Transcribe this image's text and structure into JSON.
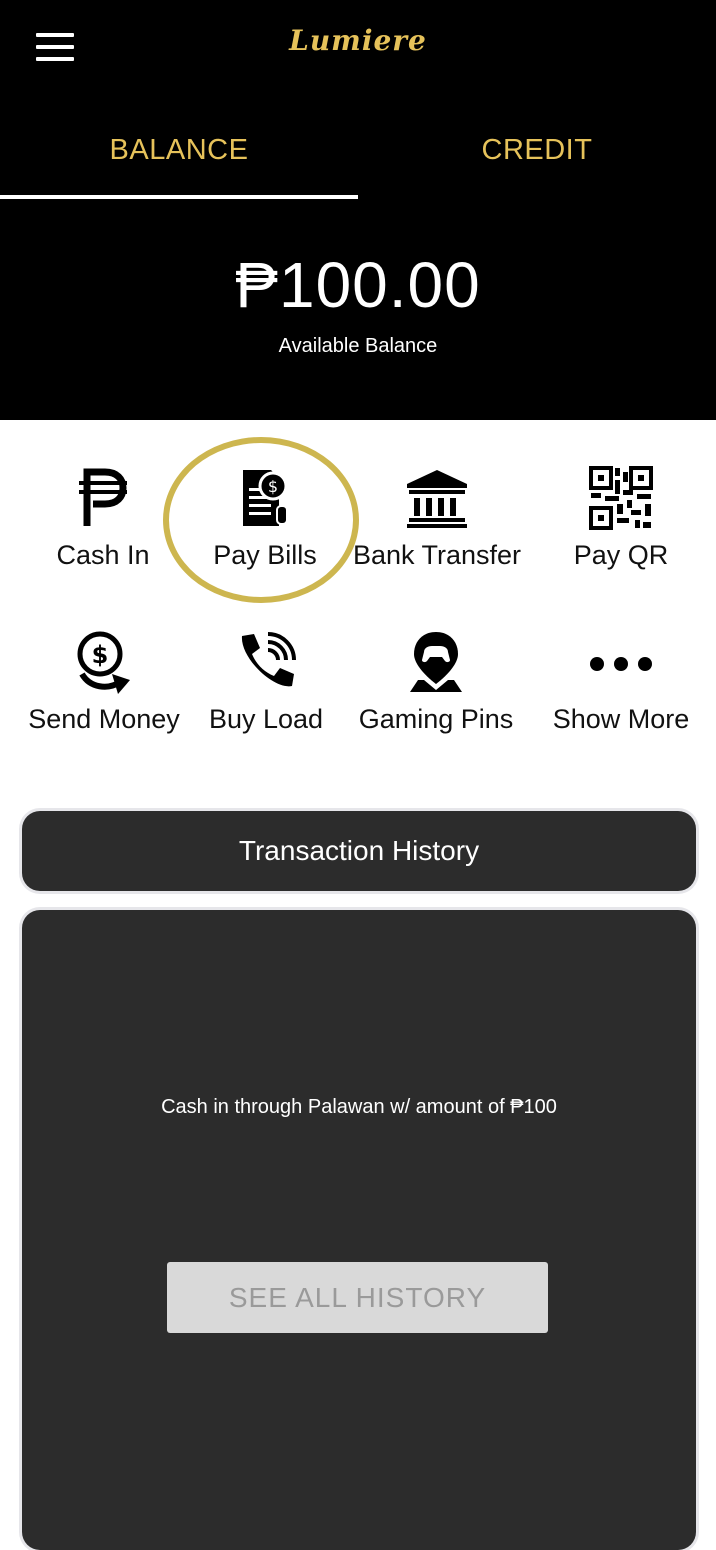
{
  "header": {
    "brand": "Lumiere",
    "tabs": [
      {
        "label": "BALANCE",
        "active": true
      },
      {
        "label": "CREDIT",
        "active": false
      }
    ],
    "balance_amount": "₱100.00",
    "balance_label": "Available Balance"
  },
  "actions": [
    {
      "label": "Cash In",
      "icon": "peso-icon"
    },
    {
      "label": "Pay Bills",
      "icon": "bill-icon"
    },
    {
      "label": "Bank Transfer",
      "icon": "bank-icon"
    },
    {
      "label": "Pay QR",
      "icon": "qr-code-icon"
    },
    {
      "label": "Send Money",
      "icon": "send-money-icon"
    },
    {
      "label": "Buy Load",
      "icon": "phone-icon"
    },
    {
      "label": "Gaming Pins",
      "icon": "gaming-pin-icon"
    },
    {
      "label": "Show More",
      "icon": "more-icon"
    }
  ],
  "history": {
    "title": "Transaction History",
    "items": [
      "Cash in through Palawan w/ amount of ₱100"
    ],
    "see_all_label": "SEE ALL HISTORY"
  },
  "colors": {
    "accent": "#e6c25a",
    "highlight_ring": "#cdb64f",
    "panel": "#2c2c2c",
    "header_bg": "#000000"
  }
}
